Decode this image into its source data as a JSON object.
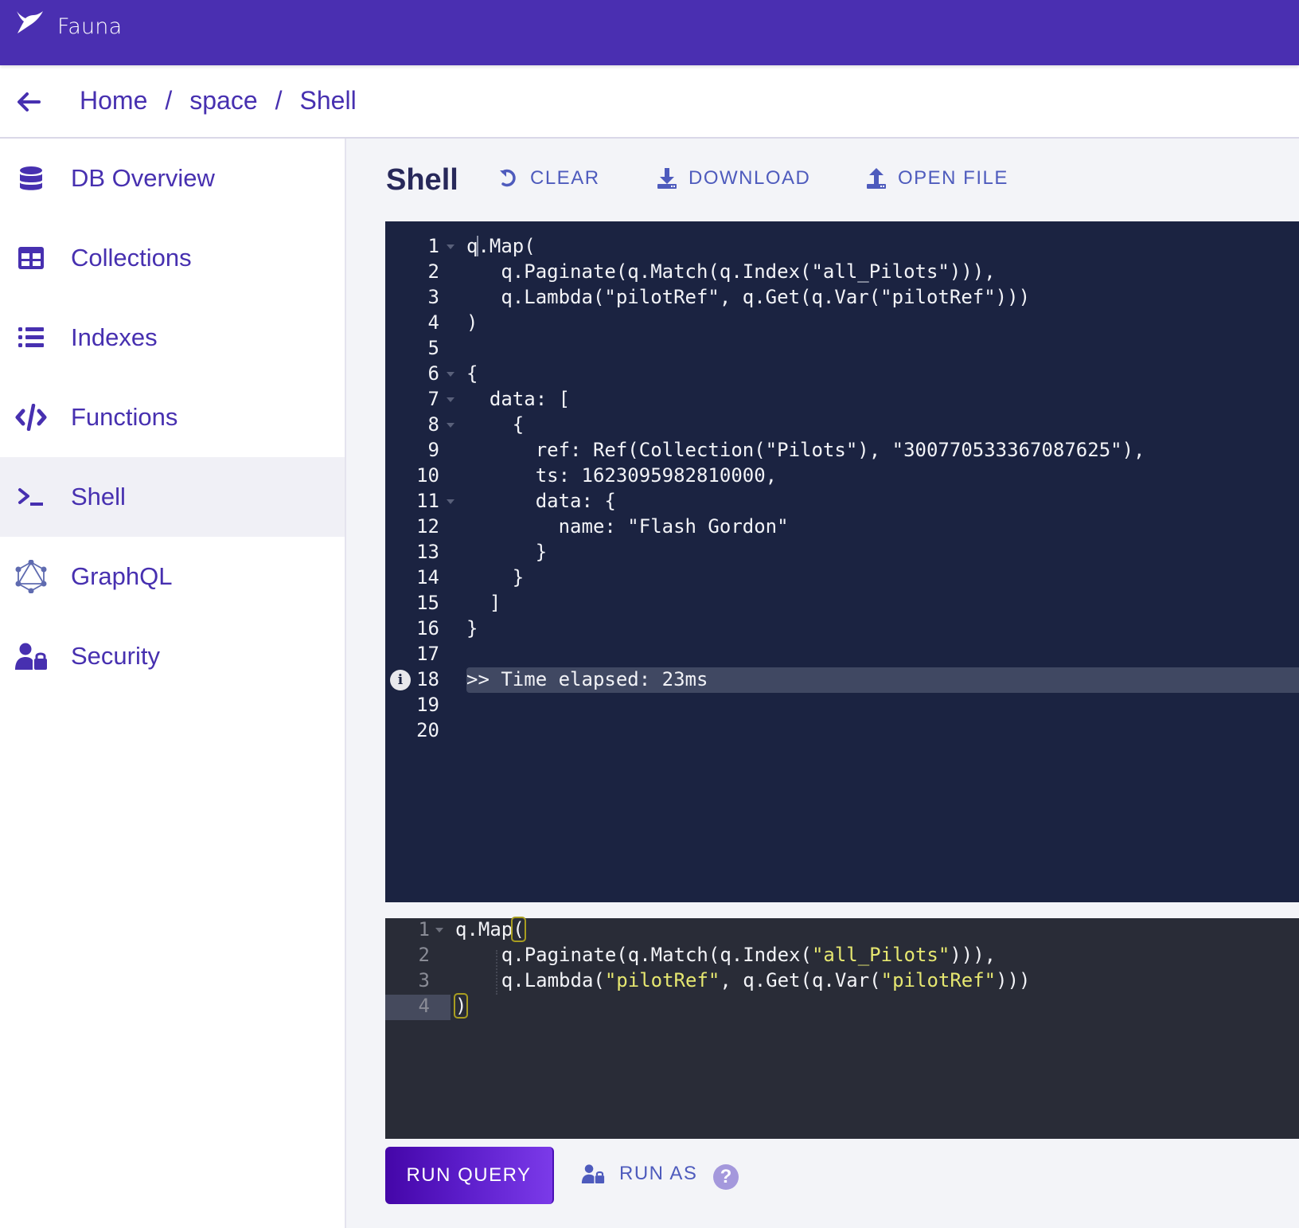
{
  "app": {
    "brand": "Fauna"
  },
  "breadcrumb": {
    "items": [
      "Home",
      "space",
      "Shell"
    ],
    "separator": "/"
  },
  "sidebar": {
    "items": [
      {
        "label": "DB Overview",
        "icon": "database-icon",
        "active": false
      },
      {
        "label": "Collections",
        "icon": "table-icon",
        "active": false
      },
      {
        "label": "Indexes",
        "icon": "list-icon",
        "active": false
      },
      {
        "label": "Functions",
        "icon": "code-icon",
        "active": false
      },
      {
        "label": "Shell",
        "icon": "terminal-icon",
        "active": true
      },
      {
        "label": "GraphQL",
        "icon": "graphql-icon",
        "active": false
      },
      {
        "label": "Security",
        "icon": "user-lock-icon",
        "active": false
      }
    ]
  },
  "main": {
    "title": "Shell",
    "toolbar": {
      "clear": "CLEAR",
      "download": "DOWNLOAD",
      "open_file": "OPEN FILE"
    }
  },
  "output_editor": {
    "lines": [
      {
        "n": "1",
        "text": "q.Map(",
        "fold": true
      },
      {
        "n": "2",
        "text": "   q.Paginate(q.Match(q.Index(\"all_Pilots\"))),",
        "fold": false
      },
      {
        "n": "3",
        "text": "   q.Lambda(\"pilotRef\", q.Get(q.Var(\"pilotRef\")))",
        "fold": false
      },
      {
        "n": "4",
        "text": ")",
        "fold": false
      },
      {
        "n": "5",
        "text": "",
        "fold": false
      },
      {
        "n": "6",
        "text": "{",
        "fold": true
      },
      {
        "n": "7",
        "text": "  data: [",
        "fold": true
      },
      {
        "n": "8",
        "text": "    {",
        "fold": true
      },
      {
        "n": "9",
        "text": "      ref: Ref(Collection(\"Pilots\"), \"300770533367087625\"),",
        "fold": false
      },
      {
        "n": "10",
        "text": "      ts: 1623095982810000,",
        "fold": false
      },
      {
        "n": "11",
        "text": "      data: {",
        "fold": true
      },
      {
        "n": "12",
        "text": "        name: \"Flash Gordon\"",
        "fold": false
      },
      {
        "n": "13",
        "text": "      }",
        "fold": false
      },
      {
        "n": "14",
        "text": "    }",
        "fold": false
      },
      {
        "n": "15",
        "text": "  ]",
        "fold": false
      },
      {
        "n": "16",
        "text": "}",
        "fold": false
      },
      {
        "n": "17",
        "text": "",
        "fold": false
      },
      {
        "n": "18",
        "text": ">> Time elapsed: 23ms",
        "fold": false,
        "highlight": true,
        "info": true
      },
      {
        "n": "19",
        "text": "",
        "fold": false
      },
      {
        "n": "20",
        "text": "",
        "fold": false
      }
    ]
  },
  "input_editor": {
    "lines": [
      {
        "n": "1",
        "fold": true,
        "parts": [
          [
            "q.Map",
            ""
          ],
          [
            "(",
            "bm"
          ]
        ]
      },
      {
        "n": "2",
        "fold": false,
        "parts": [
          [
            "    q.Paginate(q.Match(q.Index(",
            ""
          ],
          [
            "\"all_Pilots\"",
            "str"
          ],
          [
            "))),",
            ""
          ]
        ]
      },
      {
        "n": "3",
        "fold": false,
        "parts": [
          [
            "    q.Lambda(",
            ""
          ],
          [
            "\"pilotRef\"",
            "str"
          ],
          [
            ", q.Get(q.Var(",
            ""
          ],
          [
            "\"pilotRef\"",
            "str"
          ],
          [
            ")))",
            ""
          ]
        ]
      },
      {
        "n": "4",
        "fold": false,
        "active": true,
        "parts": [
          [
            ")",
            "bm"
          ]
        ]
      }
    ]
  },
  "actions": {
    "run_query": "RUN QUERY",
    "run_as": "RUN AS",
    "help": "?"
  },
  "colors": {
    "brand": "#4a2fb1",
    "link": "#4730b0",
    "output_bg": "#1b2341",
    "input_bg": "#292c37",
    "string": "#e6e770"
  }
}
